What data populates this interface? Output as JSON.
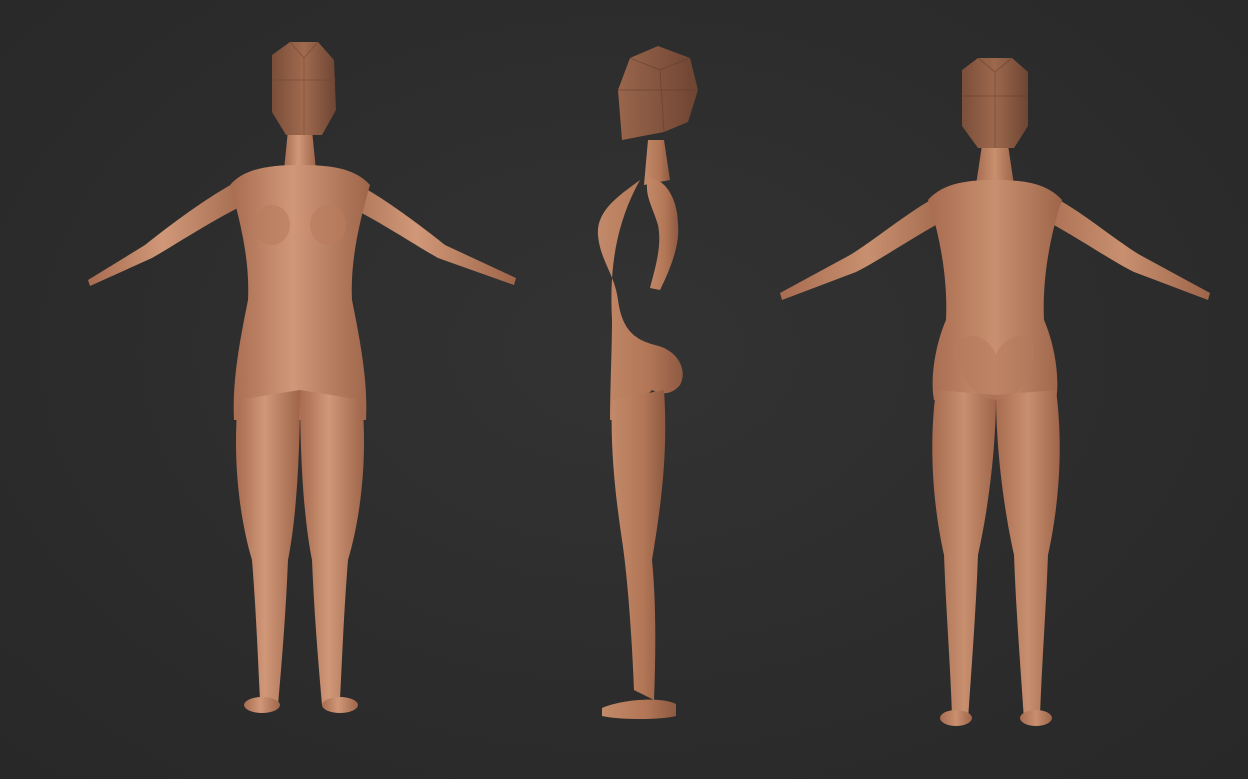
{
  "scene": {
    "background_color": "#2d2d2d",
    "skin_color": "#c58a6a",
    "skin_shadow": "#9a6248",
    "head_color": "#8f5e45",
    "views": [
      {
        "name": "front-view"
      },
      {
        "name": "side-view"
      },
      {
        "name": "back-view"
      }
    ]
  }
}
